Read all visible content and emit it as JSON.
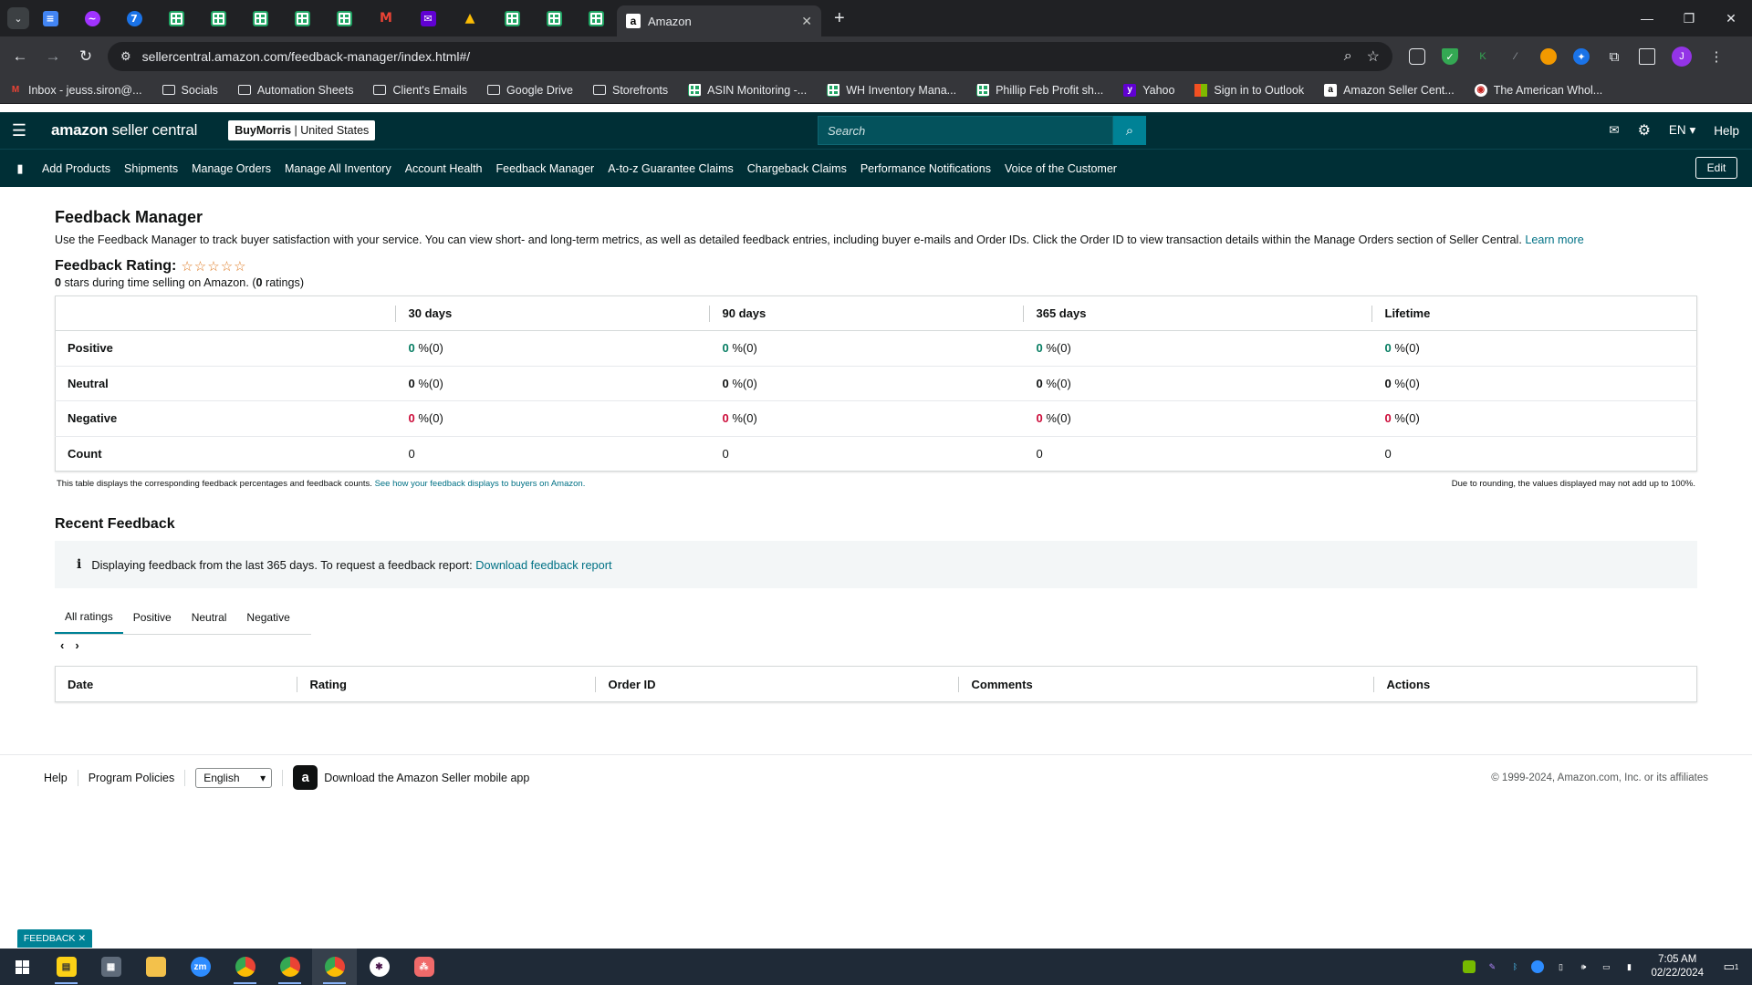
{
  "browser": {
    "active_tab_title": "Amazon",
    "url": "sellercentral.amazon.com/feedback-manager/index.html#/",
    "bookmarks": [
      {
        "label": "Inbox - jeuss.siron@...",
        "icon": "gmail-icon"
      },
      {
        "label": "Socials",
        "icon": "folder-icon"
      },
      {
        "label": "Automation Sheets",
        "icon": "folder-icon"
      },
      {
        "label": "Client's Emails",
        "icon": "folder-icon"
      },
      {
        "label": "Google Drive",
        "icon": "folder-icon"
      },
      {
        "label": "Storefronts",
        "icon": "folder-icon"
      },
      {
        "label": "ASIN Monitoring -...",
        "icon": "sheets-icon"
      },
      {
        "label": "WH Inventory Mana...",
        "icon": "sheets-icon"
      },
      {
        "label": "Phillip Feb Profit sh...",
        "icon": "sheets-icon"
      },
      {
        "label": "Yahoo",
        "icon": "yahoo-icon"
      },
      {
        "label": "Sign in to Outlook",
        "icon": "microsoft-icon"
      },
      {
        "label": "Amazon Seller Cent...",
        "icon": "amazon-icon"
      },
      {
        "label": "The American Whol...",
        "icon": "site-icon"
      }
    ],
    "profile_initial": "J"
  },
  "header": {
    "logo_brand": "amazon",
    "logo_product": "seller central",
    "store_name": "BuyMorris",
    "store_region": "United States",
    "search_placeholder": "Search",
    "language": "EN",
    "help": "Help"
  },
  "nav": {
    "items": [
      "Add Products",
      "Shipments",
      "Manage Orders",
      "Manage All Inventory",
      "Account Health",
      "Feedback Manager",
      "A-to-z Guarantee Claims",
      "Chargeback Claims",
      "Performance Notifications",
      "Voice of the Customer"
    ],
    "edit": "Edit"
  },
  "page": {
    "title": "Feedback Manager",
    "description": "Use the Feedback Manager to track buyer satisfaction with your service. You can view short- and long-term metrics, as well as detailed feedback entries, including buyer e-mails and Order IDs. Click the Order ID to view transaction details within the Manage Orders section of Seller Central.",
    "learn_more": "Learn more",
    "rating_label": "Feedback Rating:",
    "rating_stars": 0,
    "rating_summary_stars": "0",
    "rating_summary_mid": " stars during time selling on Amazon. (",
    "rating_summary_count": "0",
    "rating_summary_end": " ratings)"
  },
  "metrics": {
    "columns": [
      "30 days",
      "90 days",
      "365 days",
      "Lifetime"
    ],
    "rows": [
      {
        "label": "Positive",
        "values": [
          {
            "pct": "0",
            "rest": " %(0)"
          },
          {
            "pct": "0",
            "rest": " %(0)"
          },
          {
            "pct": "0",
            "rest": " %(0)"
          },
          {
            "pct": "0",
            "rest": " %(0)"
          }
        ]
      },
      {
        "label": "Neutral",
        "values": [
          {
            "pct": "0",
            "rest": " %(0)"
          },
          {
            "pct": "0",
            "rest": " %(0)"
          },
          {
            "pct": "0",
            "rest": " %(0)"
          },
          {
            "pct": "0",
            "rest": " %(0)"
          }
        ]
      },
      {
        "label": "Negative",
        "values": [
          {
            "pct": "0",
            "rest": " %(0)"
          },
          {
            "pct": "0",
            "rest": " %(0)"
          },
          {
            "pct": "0",
            "rest": " %(0)"
          },
          {
            "pct": "0",
            "rest": " %(0)"
          }
        ]
      },
      {
        "label": "Count",
        "values": [
          "0",
          "0",
          "0",
          "0"
        ]
      }
    ],
    "note": "This table displays the corresponding feedback percentages and feedback counts.",
    "note_link": "See how your feedback displays to buyers on Amazon.",
    "rounding_note": "Due to rounding, the values displayed may not add up to 100%."
  },
  "recent": {
    "title": "Recent Feedback",
    "info_text": "Displaying feedback from the last 365 days. To request a feedback report:",
    "info_link": "Download feedback report",
    "tabs": [
      "All ratings",
      "Positive",
      "Neutral",
      "Negative"
    ],
    "active_tab": "All ratings",
    "columns": [
      "Date",
      "Rating",
      "Order ID",
      "Comments",
      "Actions"
    ]
  },
  "footer": {
    "help": "Help",
    "policies": "Program Policies",
    "language": "English",
    "app_text": "Download the Amazon Seller mobile app",
    "copyright": "© 1999-2024, Amazon.com, Inc. or its affiliates",
    "feedback_button": "FEEDBACK"
  },
  "taskbar": {
    "time": "7:05 AM",
    "date": "02/22/2024",
    "notification_count": "1"
  },
  "colors": {
    "header_bg": "#002f36",
    "accent": "#008296",
    "link": "#007185",
    "positive": "#067d62",
    "negative": "#cc0c39",
    "star": "#de7921"
  }
}
